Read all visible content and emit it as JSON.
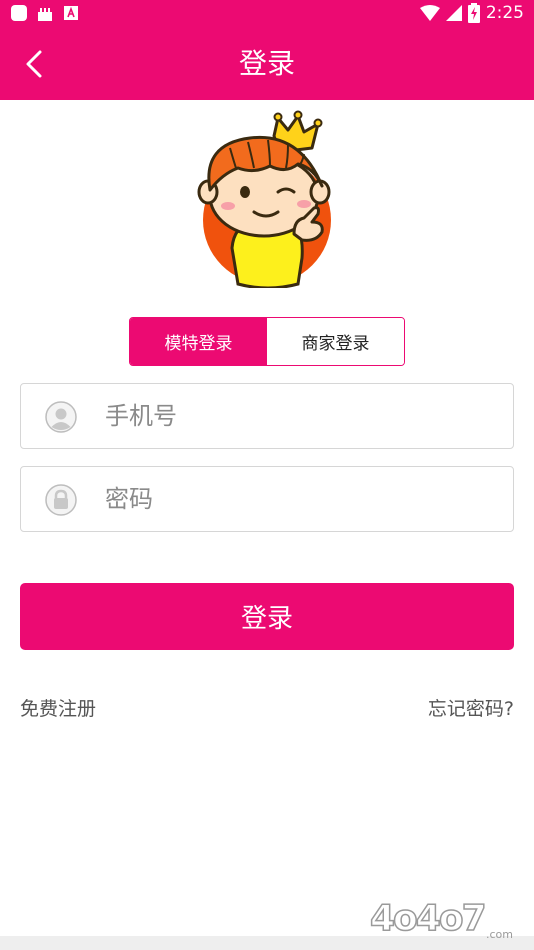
{
  "status_bar": {
    "time": "2:25",
    "icons": [
      "square-app-icon",
      "cake-icon",
      "a-badge-icon",
      "wifi-icon",
      "signal-icon",
      "battery-charging-icon"
    ]
  },
  "app_bar": {
    "title": "登录",
    "back_icon": "chevron-left-icon"
  },
  "tabs": [
    {
      "label": "模特登录",
      "active": true
    },
    {
      "label": "商家登录",
      "active": false
    }
  ],
  "phone_field": {
    "placeholder": "手机号",
    "value": "",
    "icon": "user-icon"
  },
  "password_field": {
    "placeholder": "密码",
    "value": "",
    "icon": "lock-icon"
  },
  "login_button": {
    "label": "登录"
  },
  "links": {
    "register": "免费注册",
    "forgot": "忘记密码?"
  },
  "watermark": {
    "text": "4o4o7",
    "suffix": ".com"
  },
  "colors": {
    "primary": "#ec0a72",
    "border": "#d6d6d6",
    "placeholder": "#8a8a8a"
  }
}
